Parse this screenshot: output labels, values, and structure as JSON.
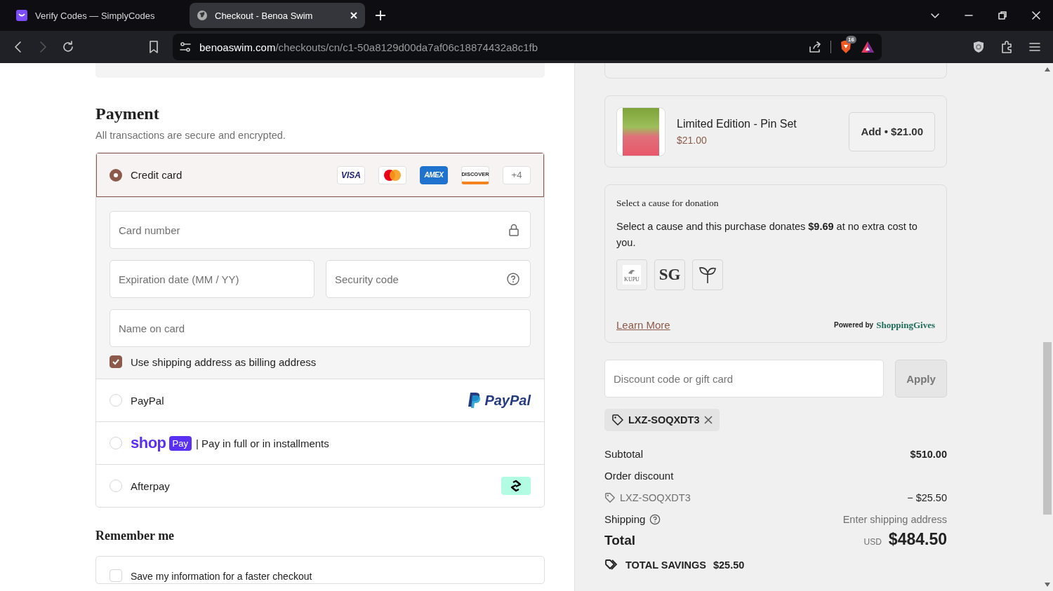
{
  "browser": {
    "tabs": [
      {
        "kind": "simplycodes",
        "title": "Verify Codes — SimplyCodes",
        "selected": false
      },
      {
        "kind": "site",
        "title": "Checkout - Benoa Swim",
        "selected": true
      }
    ],
    "forward_disabled": true,
    "url": {
      "domain": "benoaswim.com",
      "path": "/checkouts/cn/c1-50a8129d00da7af06c18874432a8c1fb"
    },
    "shields_count": "16"
  },
  "payment": {
    "heading": "Payment",
    "subtitle": "All transactions are secure and encrypted.",
    "methods": [
      {
        "kind": "card",
        "label": "Credit card",
        "selected": true,
        "brands": [
          {
            "kind": "visa",
            "label": "VISA"
          },
          {
            "kind": "mastercard"
          },
          {
            "kind": "amex",
            "label": "AMEX"
          },
          {
            "kind": "discover",
            "label": "DISCOVER"
          }
        ],
        "more": "+4"
      },
      {
        "kind": "paypal",
        "label": "PayPal",
        "selected": false,
        "logo": "PayPal"
      },
      {
        "kind": "shoppay",
        "logo": "shop",
        "badge": "Pay",
        "label": "| Pay in full or in installments",
        "selected": false
      },
      {
        "kind": "afterpay",
        "label": "Afterpay",
        "selected": false
      }
    ],
    "card_fields": {
      "card_number": {
        "placeholder": "Card number"
      },
      "expiration": {
        "placeholder": "Expiration date (MM / YY)"
      },
      "security_code": {
        "placeholder": "Security code"
      },
      "name": {
        "placeholder": "Name on card"
      }
    },
    "billing_same": {
      "label": "Use shipping address as billing address",
      "checked": true
    }
  },
  "remember": {
    "heading": "Remember me",
    "option": {
      "label": "Save my information for a faster checkout",
      "checked": false
    }
  },
  "upsell": {
    "name": "Limited Edition - Pin Set",
    "price": "$21.00",
    "button": "Add • $21.00"
  },
  "donation": {
    "title": "Select a cause for donation",
    "text": "Select a cause and this purchase donates **$9.69** at no extra cost to you.",
    "causes": [
      {
        "kind": "logo",
        "label": "KUPU"
      },
      {
        "kind": "initials",
        "label": "SG"
      },
      {
        "kind": "sprout"
      }
    ],
    "learn_more": "Learn More",
    "powered_by": "Powered by",
    "brand": "ShoppingGives"
  },
  "discount": {
    "placeholder": "Discount code or gift card",
    "button": "Apply",
    "applied_code": "LXZ-SOQXDT3"
  },
  "summary": {
    "subtotal": {
      "label": "Subtotal",
      "value": "$510.00"
    },
    "order_discount": {
      "label": "Order discount",
      "code": "LXZ-SOQXDT3",
      "value": "− $25.50"
    },
    "shipping": {
      "label": "Shipping",
      "value": "Enter shipping address"
    },
    "total": {
      "label": "Total",
      "currency": "USD",
      "value": "$484.50"
    },
    "savings": {
      "label": "TOTAL SAVINGS",
      "value": "$25.50"
    }
  }
}
